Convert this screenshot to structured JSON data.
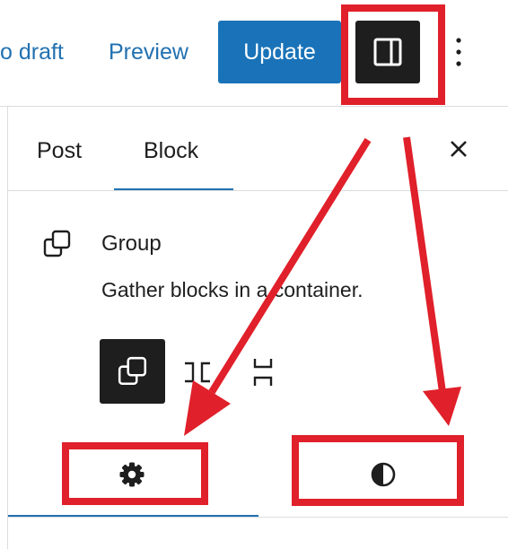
{
  "toolbar": {
    "draft_label": "o draft",
    "preview_label": "Preview",
    "update_label": "Update",
    "settings_toggle_icon": "sidebar-icon",
    "more_icon": "more-vertical-icon"
  },
  "sidebar": {
    "tabs": [
      {
        "label": "Post",
        "active": false
      },
      {
        "label": "Block",
        "active": true
      }
    ],
    "close_icon": "close-icon"
  },
  "block_card": {
    "icon": "group-icon",
    "title": "Group",
    "description": "Gather blocks in a container."
  },
  "variations": [
    {
      "icon": "group-icon",
      "selected": true
    },
    {
      "icon": "row-icon",
      "selected": false
    },
    {
      "icon": "stack-icon",
      "selected": false
    }
  ],
  "inspector_tabs": [
    {
      "icon": "gear-icon",
      "active": true
    },
    {
      "icon": "half-circle-icon",
      "active": false
    }
  ],
  "colors": {
    "accent": "#2271b1",
    "update_button": "#1a73b8",
    "dark": "#1e1e1e",
    "annotation": "#e0202a"
  }
}
